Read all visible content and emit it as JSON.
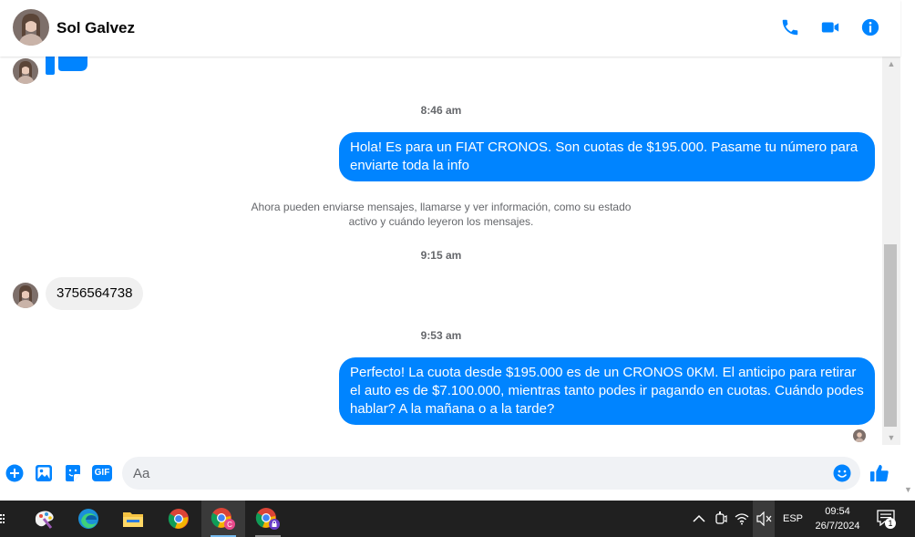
{
  "contact": {
    "name": "Sol Galvez"
  },
  "header_actions": [
    "phone-icon",
    "video-icon",
    "info-icon"
  ],
  "messages": {
    "time_1": "8:46 am",
    "out_1": "Hola! Es para un FIAT CRONOS. Son cuotas de $195.000. Pasame tu número para enviarte toda la info",
    "system": "Ahora pueden enviarse mensajes, llamarse y ver información, como su estado activo y cuándo leyeron los mensajes.",
    "time_2": "9:15 am",
    "in_1": "3756564738",
    "time_3": "9:53 am",
    "out_2": "Perfecto! La cuota desde $195.000 es de un CRONOS 0KM. El anticipo para retirar el auto es de $7.100.000, mientras tanto podes ir pagando en cuotas. Cuándo podes hablar? A la mañana o a la tarde?"
  },
  "composer": {
    "placeholder": "Aa",
    "gif_label": "GIF"
  },
  "colors": {
    "accent": "#0084ff",
    "incoming_bubble": "#f0f0f0",
    "taskbar": "#202020"
  },
  "taskbar": {
    "language": "ESP",
    "time": "09:54",
    "date": "26/7/2024",
    "notification_count": "1",
    "apps": [
      "paint-icon",
      "edge-icon",
      "file-explorer-icon",
      "chrome-icon",
      "chrome-profile-c-icon",
      "chrome-profile-locked-icon"
    ]
  }
}
